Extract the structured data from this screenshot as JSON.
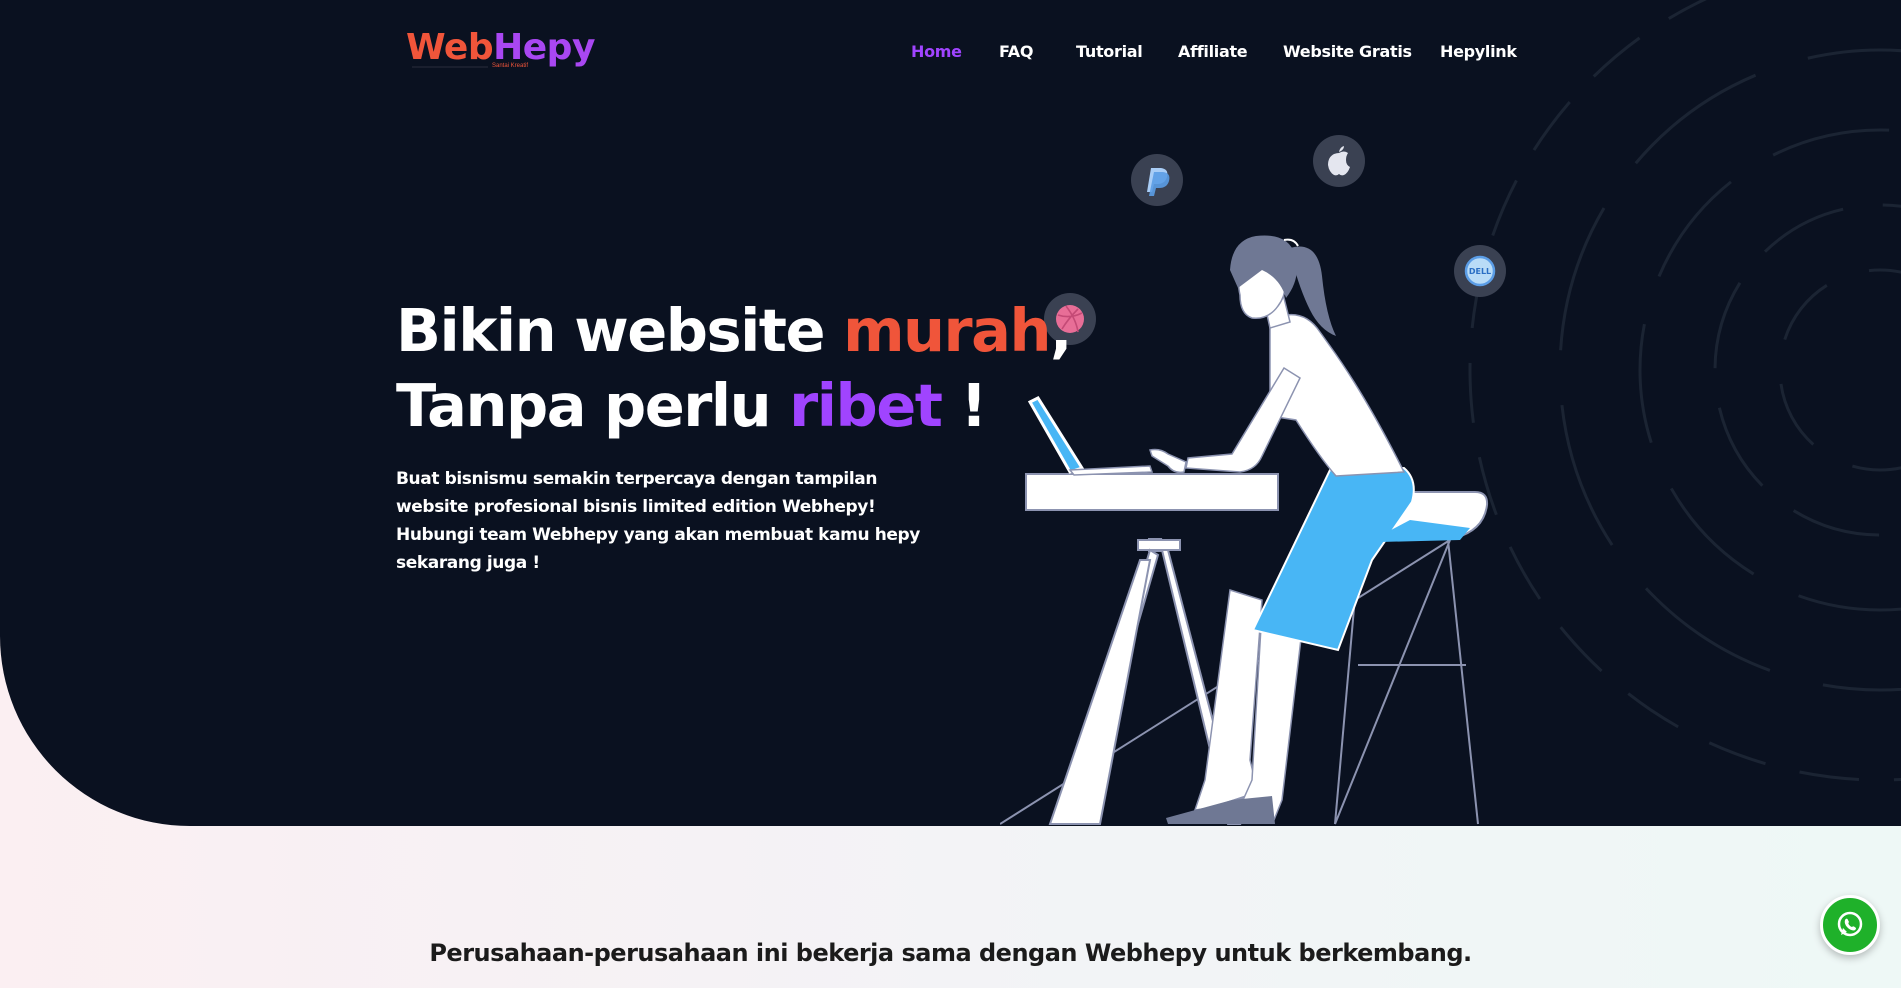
{
  "brand": {
    "name_part1": "Web",
    "name_part2": "Hepy",
    "tagline": "Santai Kreatif"
  },
  "nav": {
    "items": [
      {
        "label": "Home",
        "active": true
      },
      {
        "label": "FAQ",
        "active": false
      },
      {
        "label": "Tutorial",
        "active": false
      },
      {
        "label": "Affiliate",
        "active": false
      },
      {
        "label": "Website Gratis",
        "active": false
      },
      {
        "label": "Hepylink",
        "active": false
      }
    ]
  },
  "hero": {
    "line1_prefix": "Bikin website ",
    "line1_accent": "murah",
    "line1_suffix": ",",
    "line2_prefix": "Tanpa perlu ",
    "line2_accent": "ribet",
    "line2_suffix": " !",
    "description_lines": [
      "Buat bisnismu semakin terpercaya dengan tampilan",
      "website profesional bisnis limited edition Webhepy!",
      "Hubungi team Webhepy yang akan membuat kamu hepy",
      "sekarang juga !"
    ]
  },
  "floating_icons": [
    "paypal-icon",
    "apple-icon",
    "dell-icon",
    "dribbble-icon"
  ],
  "partners": {
    "heading": "Perusahaan-perusahaan ini bekerja sama dengan Webhepy untuk berkembang."
  },
  "colors": {
    "hero_bg": "#0a1120",
    "accent_orange": "#f0553a",
    "accent_purple": "#a044ff",
    "whatsapp_green": "#1fb12a",
    "skirt_blue": "#48b6f5"
  }
}
